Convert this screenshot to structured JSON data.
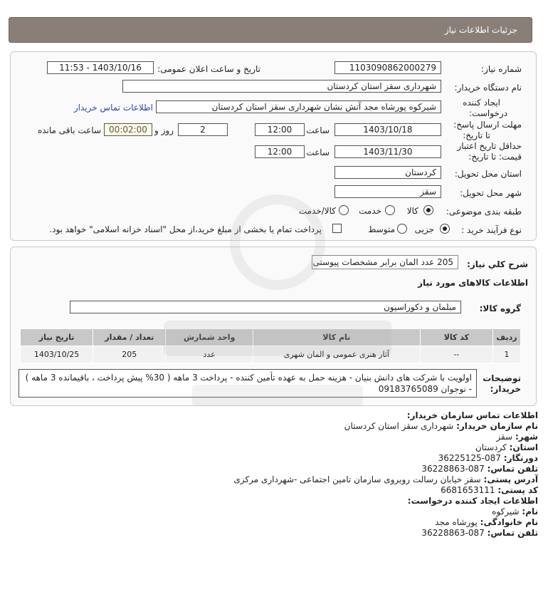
{
  "header": {
    "title": "جزئیات اطلاعات نیاز"
  },
  "form": {
    "need_number_label": "شماره نیاز:",
    "need_number": "1103090862000279",
    "announce_label": "تاریخ و ساعت اعلان عمومی:",
    "announce_value": "1403/10/16 - 11:53",
    "buyer_org_label": "نام دستگاه خریدار:",
    "buyer_org": "شهرداری سقز استان کردستان",
    "creator_label_1": "ایجاد کننده",
    "creator_label_2": "درخواست:",
    "creator": "شیرکوه پورشاه مجد آتش نشان شهرداری سقز استان کردستان",
    "contact_link": "اطلاعات تماس خریدار",
    "deadline_label_1": "مهلت ارسال پاسخ:",
    "deadline_label_2": "تا تاریخ:",
    "deadline_date": "1403/10/18",
    "time_label": "ساعت",
    "deadline_time": "12:00",
    "days_value": "2",
    "days_label": "روز و",
    "remaining_value": "00:02:00",
    "remaining_label": "ساعت باقی مانده",
    "validity_label_1": "حداقل تاریخ اعتبار",
    "validity_label_2": "قیمت: تا تاریخ:",
    "validity_date": "1403/11/30",
    "validity_time": "12:00",
    "province_label": "استان محل تحویل:",
    "province": "کردستان",
    "city_label": "شهر محل تحویل:",
    "city": "سقز",
    "category_label": "طبقه بندی موضوعی:",
    "category_options": [
      "کالا",
      "خدمت",
      "کالا/خدمت"
    ],
    "process_label": "نوع فرآیند خرید :",
    "process_options": [
      "جزیی",
      "متوسط"
    ],
    "payment_note": "پرداخت تمام یا بخشی از مبلغ خرید،از محل \"اسناد خزانه اسلامی\" خواهد بود."
  },
  "description": {
    "label": "شرح کلي نياز:",
    "value": "205 عدد المان برابر مشخصات پیوستی"
  },
  "goods": {
    "section_title": "اطلاعات کالاهای مورد نیاز",
    "group_label": "گروه کالا:",
    "group_value": "مبلمان و دکوراسیون",
    "columns": [
      "ردیف",
      "کد کالا",
      "نام کالا",
      "واحد شمارش",
      "تعداد / مقدار",
      "تاریخ نیاز"
    ],
    "rows": [
      [
        "1",
        "--",
        "آثار هنری عمومی و المان شهری",
        "عدد",
        "205",
        "1403/10/25"
      ]
    ]
  },
  "notes": {
    "label_1": "توضیحات",
    "label_2": "خریدار:",
    "text": "اولویت با شرکت های دانش بنیان - هزینه حمل به عهده تأمین کننده - پرداخت 3 ماهه ( 30% پیش پرداخت ، باقیمانده 3 ماهه ) - نوجوان 09183765089"
  },
  "buyer_contact": {
    "title": "اطلاعات تماس سازمان خریدار:",
    "org_label": "نام سازمان خریدار:",
    "org": "شهرداری سقز استان کردستان",
    "city_label": "شهر:",
    "city": "سقز",
    "province_label": "استان:",
    "province": "کردستان",
    "fax_label": "دورنگار:",
    "fax": "087-36225125",
    "phone_label": "تلفن تماس:",
    "phone": "087-36228863",
    "address_label": "آدرس پستی:",
    "address": "سقز خیابان رسالت روبروی سازمان تامین اجتماعی -شهرداری مرکزی",
    "postal_label": "کد پستی:",
    "postal": "6681653111"
  },
  "creator_contact": {
    "title": "اطلاعات ایجاد کننده درخواست:",
    "name_label": "نام:",
    "name": "شیرکوه",
    "family_label": "نام خانوادگی:",
    "family": "پورشاه مجد",
    "phone_label": "تلفن تماس:",
    "phone": "087-36228863"
  }
}
